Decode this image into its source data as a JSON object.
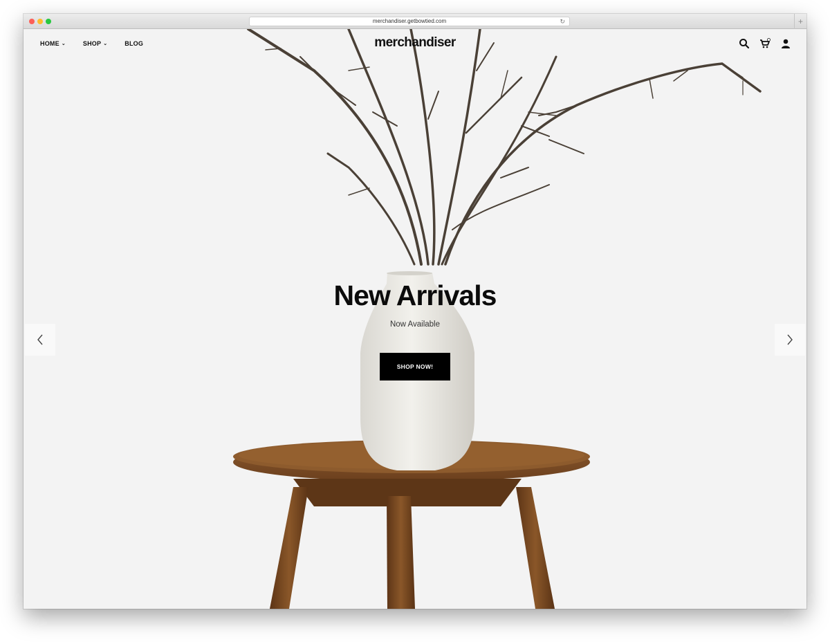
{
  "browser": {
    "url": "merchandiser.getbowtied.com"
  },
  "nav": {
    "items": [
      {
        "label": "HOME",
        "has_dropdown": true
      },
      {
        "label": "SHOP",
        "has_dropdown": true
      },
      {
        "label": "BLOG",
        "has_dropdown": false
      }
    ],
    "logo": "merchandiser",
    "icons": [
      "search-icon",
      "cart-icon",
      "account-icon"
    ]
  },
  "hero": {
    "title": "New Arrivals",
    "subtitle": "Now Available",
    "button_label": "SHOP NOW!"
  },
  "colors": {
    "background": "#f3f3f3",
    "button": "#000000",
    "wood": "#7a4a24",
    "vase": "#ecebe6"
  }
}
